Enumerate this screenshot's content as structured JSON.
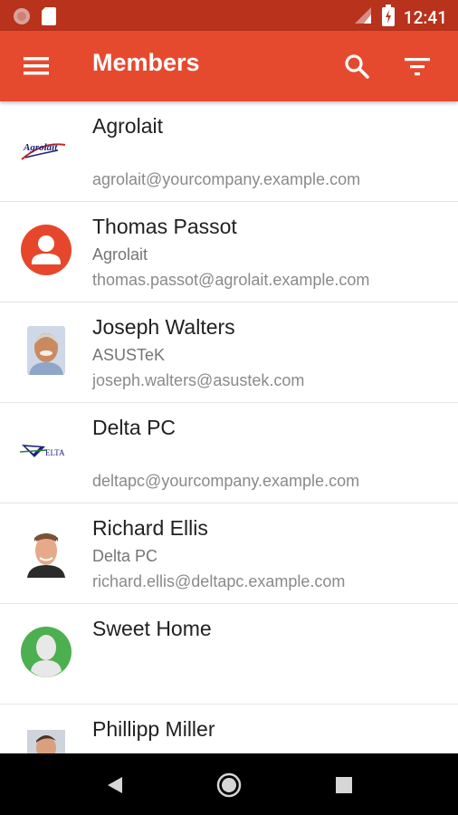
{
  "status_bar": {
    "time": "12:41",
    "icons": [
      "notification-dot-icon",
      "sd-card-icon",
      "signal-icon",
      "battery-charging-icon"
    ]
  },
  "app_bar": {
    "title": "Members",
    "icons": [
      "menu-icon",
      "search-icon",
      "filter-icon"
    ],
    "background_color": "#e64a2e"
  },
  "members": [
    {
      "name": "Agrolait",
      "company": "",
      "email": "agrolait@yourcompany.example.com",
      "avatar": "agrolait-logo"
    },
    {
      "name": "Thomas Passot",
      "company": "Agrolait",
      "email": "thomas.passot@agrolait.example.com",
      "avatar": "default-person-red"
    },
    {
      "name": "Joseph Walters",
      "company": "ASUSTeK",
      "email": "joseph.walters@asustek.com",
      "avatar": "photo-joseph"
    },
    {
      "name": "Delta PC",
      "company": "",
      "email": "deltapc@yourcompany.example.com",
      "avatar": "delta-logo"
    },
    {
      "name": "Richard Ellis",
      "company": "Delta PC",
      "email": "richard.ellis@deltapc.example.com",
      "avatar": "photo-richard"
    },
    {
      "name": "Sweet Home",
      "company": "",
      "email": "",
      "avatar": "default-person-green"
    },
    {
      "name": "Phillipp Miller",
      "company": "",
      "email": "",
      "avatar": "photo-phillipp"
    }
  ],
  "logos": {
    "agrolait_text": "Agrolait",
    "delta_text": "ELTA"
  },
  "nav_bar": {
    "buttons": [
      "back-icon",
      "home-icon",
      "recents-icon"
    ]
  }
}
